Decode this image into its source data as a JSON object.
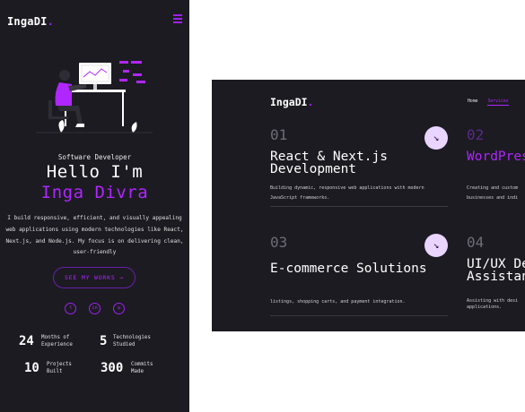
{
  "mobile": {
    "logo": "IngaDI",
    "logo_dot": ".",
    "subtitle": "Software Developer",
    "hello": "Hello I'm",
    "name": "Inga Divra",
    "description": "I build responsive, efficient, and visually appealing web applications using modern technologies like React, Next.js, and Node.js. My focus is on delivering clean, user-friendly",
    "cta_label": "SEE MY WORKS →",
    "socials": [
      {
        "icon": "github-icon",
        "glyph": "⌥"
      },
      {
        "icon": "linkedin-icon",
        "glyph": "in"
      },
      {
        "icon": "instagram-icon",
        "glyph": "◎"
      }
    ],
    "stats": [
      {
        "number": "24",
        "label_line1": "Months of",
        "label_line2": "Experience"
      },
      {
        "number": "5",
        "label_line1": "Technologies",
        "label_line2": "Studied"
      },
      {
        "number": "10",
        "label_line1": "Projects",
        "label_line2": "Built"
      },
      {
        "number": "300",
        "label_line1": "Commits",
        "label_line2": "Made"
      }
    ]
  },
  "desktop": {
    "logo": "IngaDI",
    "logo_dot": ".",
    "nav": [
      "Home",
      "Services"
    ],
    "arrow_glyph": "↘",
    "services": [
      {
        "number": "01",
        "title_line1": "React & Next.js",
        "title_line2": "Development",
        "desc_line1": "Building dynamic, responsive web applications with modern",
        "desc_line2": "JavaScript frameworks."
      },
      {
        "number": "02",
        "title_line1": "WordPres",
        "title_line2": "",
        "desc_line1": "Creating and custom",
        "desc_line2": "businesses and indi"
      },
      {
        "number": "03",
        "title_line1": "E-commerce Solutions",
        "title_line2": "",
        "desc_line1": "listings, shopping carts, and payment integration.",
        "desc_line2": ""
      },
      {
        "number": "04",
        "title_line1": "UI/UX De",
        "title_line2": "Assistan",
        "desc_line1": "Assisting with desi",
        "desc_line2": "applications."
      }
    ]
  },
  "colors": {
    "background": "#1c1b22",
    "accent": "#b026ff",
    "arrow_bg": "#e9d5ff"
  }
}
